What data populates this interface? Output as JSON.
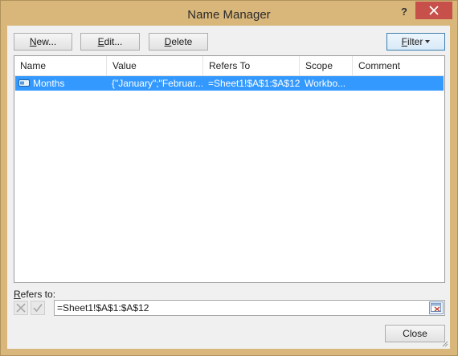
{
  "window": {
    "title": "Name Manager",
    "help_glyph": "?"
  },
  "toolbar": {
    "new_label_prefix": "",
    "new_label_ul": "N",
    "new_label_rest": "ew...",
    "edit_label_ul": "E",
    "edit_label_rest": "dit...",
    "delete_label_ul": "D",
    "delete_label_rest": "elete",
    "filter_label_ul": "F",
    "filter_label_rest": "ilter"
  },
  "list": {
    "columns": [
      "Name",
      "Value",
      "Refers To",
      "Scope",
      "Comment"
    ],
    "rows": [
      {
        "name": "Months",
        "value": "{\"January\";\"Februar...",
        "refers_to": "=Sheet1!$A$1:$A$12",
        "scope": "Workbo...",
        "comment": "",
        "selected": true
      }
    ]
  },
  "refers": {
    "label_ul": "R",
    "label_rest": "efers to:",
    "value": "=Sheet1!$A$1:$A$12"
  },
  "footer": {
    "close_label": "Close"
  },
  "colors": {
    "accent": "#3399ff",
    "frame": "#d9b67a",
    "close_btn": "#c7504a"
  },
  "icons": [
    "help-icon",
    "close-icon",
    "name-icon",
    "cancel-icon",
    "confirm-icon",
    "collapse-dialog-icon",
    "resize-grip-icon"
  ]
}
